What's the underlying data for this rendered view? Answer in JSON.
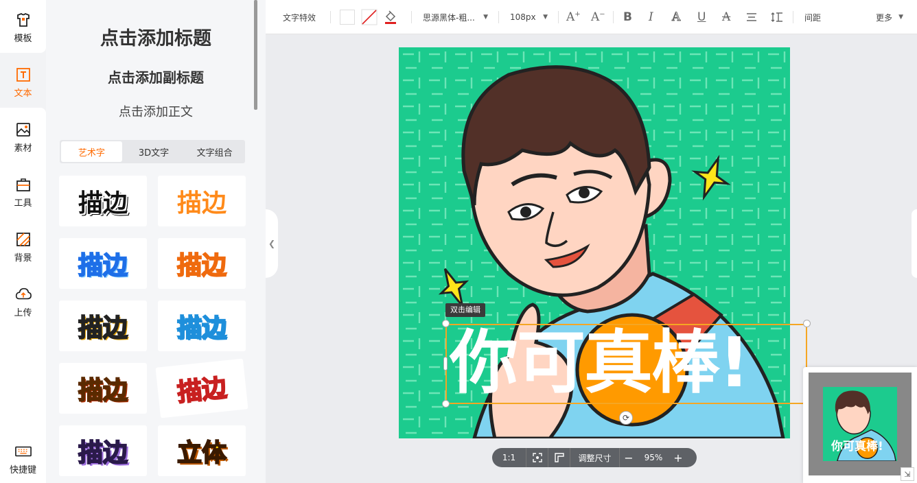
{
  "nav": {
    "items": [
      {
        "label": "模板",
        "icon": "template-icon"
      },
      {
        "label": "文本",
        "icon": "text-icon"
      },
      {
        "label": "素材",
        "icon": "material-icon"
      },
      {
        "label": "工具",
        "icon": "toolbox-icon"
      },
      {
        "label": "背景",
        "icon": "background-icon"
      },
      {
        "label": "上传",
        "icon": "upload-icon"
      }
    ],
    "shortcut": {
      "label": "快捷键",
      "icon": "keyboard-icon"
    }
  },
  "panel": {
    "title": "点击添加标题",
    "subtitle": "点击添加副标题",
    "body": "点击添加正文",
    "tabs": [
      "艺术字",
      "3D文字",
      "文字组合"
    ],
    "cards": [
      "描边",
      "描边",
      "描边",
      "描边",
      "描边",
      "描边",
      "描边",
      "描边",
      "描边",
      "立体"
    ]
  },
  "toolbar": {
    "effect": "文字特效",
    "font": "思源黑体-粗...",
    "size": "108px",
    "spacing": "间距",
    "more": "更多"
  },
  "canvas": {
    "tooltip": "双击编辑",
    "headline": "你可真棒!",
    "minimap_text": "你可真棒!"
  },
  "zoom": {
    "ratio": "1:1",
    "resize": "调整尺寸",
    "minus": "−",
    "level": "95%",
    "plus": "+"
  },
  "colors": {
    "accent": "#ff6a00",
    "poster_bg": "#1ccb8e",
    "orange_circle": "#ff9a00",
    "shirt": "#7fd3f0",
    "hair": "#523028",
    "skin": "#ffd5c2"
  }
}
